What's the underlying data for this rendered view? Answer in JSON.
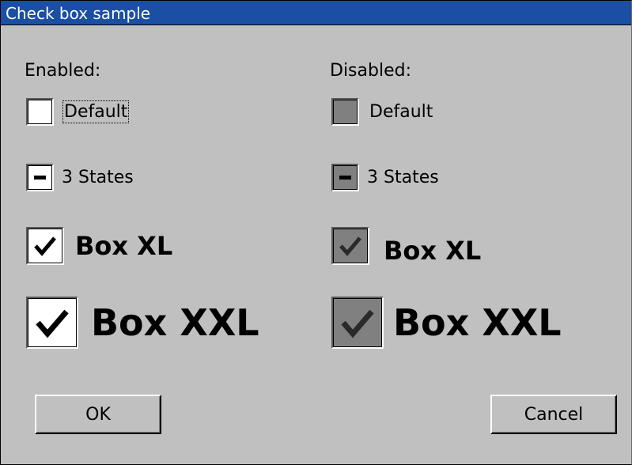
{
  "window": {
    "title": "Check box sample"
  },
  "sections": {
    "enabled_label": "Enabled:",
    "disabled_label": "Disabled:"
  },
  "enabled": {
    "default": {
      "label": "Default",
      "state": "unchecked"
    },
    "three_states": {
      "label": "3 States",
      "state": "indeterminate"
    },
    "box_xl": {
      "label": "Box XL",
      "state": "checked"
    },
    "box_xxl": {
      "label": "Box XXL",
      "state": "checked"
    }
  },
  "disabled": {
    "default": {
      "label": "Default",
      "state": "unchecked"
    },
    "three_states": {
      "label": "3 States",
      "state": "indeterminate"
    },
    "box_xl": {
      "label": "Box XL",
      "state": "checked"
    },
    "box_xxl": {
      "label": "Box XXL",
      "state": "checked"
    }
  },
  "buttons": {
    "ok": "OK",
    "cancel": "Cancel"
  },
  "colors": {
    "title_bar": "#1a4fa3",
    "dialog_bg": "#c0c0c0",
    "disabled_box": "#808080"
  }
}
